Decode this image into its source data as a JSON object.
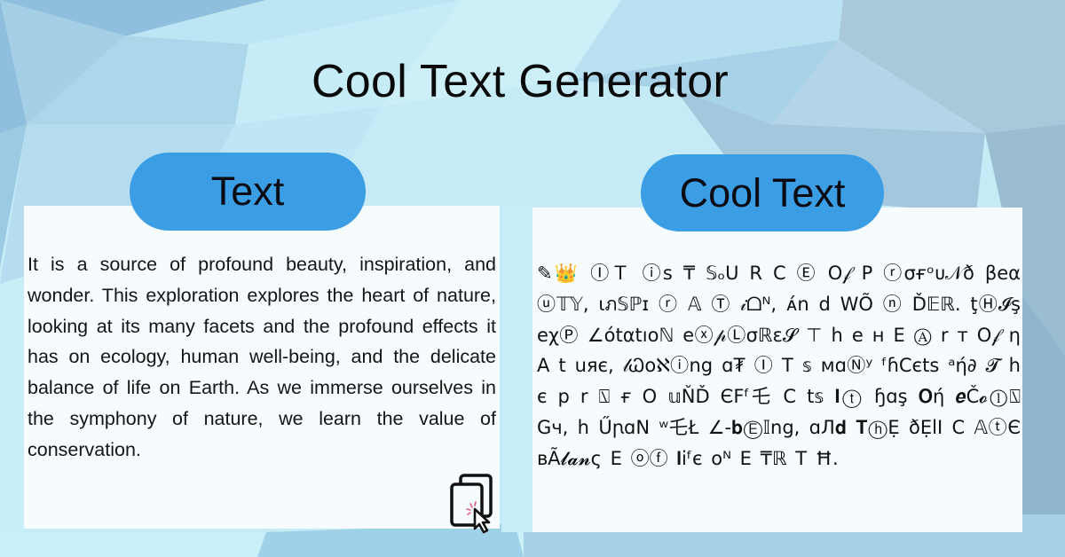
{
  "page": {
    "title": "Cool Text Generator"
  },
  "input_panel": {
    "label": "Text",
    "content": "It is a source of profound beauty, inspiration, and wonder. This exploration explores the heart of nature, looking at its many facets and the profound effects it has on ecology, human well-being, and the delicate balance of life on Earth. As we immerse ourselves in the symphony of nature, we learn the value of conservation."
  },
  "output_panel": {
    "label": "Cool Text",
    "content": "✎👑  ⒾＴ ⓘs ₸ 𝕊ₒU R C Ⓔ  O𝒻 P ⓡσғᵒᴜ𝒩ð βeα ⓤ𝕋𝕐, ɩภ𝕊ℙɪ ⓡ 𝔸 Ⓣ 𝒾ᗝᴺ, ᴀ́n d  WÕ ⓝ Ď𝔼ℝ. ţⒽ𝓘ş eχⓅ ∠ótαtıoℕ eⓧ𝓅Ⓛσℝɛ𝓢 ⊤ h e ʜ E Ⓐ r ᴛ O𝒻 η A  t uяє, 𝓁Ꮗoℵⓘng ɑ₮  Ⓘ T 𝕤 ᴍɑⓃʸ ᶠɦCєts ᵃή∂ 𝓣 h є  p r ⍂ ғ O 𝕦ŇĎ ЄFᶠ乇 C t𝕤 𝐈ⓣ  ɧɑş 𝐎ή 𝒆Č𝓸ⓛ⍂ Gч,  h ŰꞃɑN ʷ乇Ł ∠-𝐛Ⓔ𝕀ng, ɑЛ𝐝 𝐓ⓗẸ ðẸlI C 𝔸ⓣЄ ʙÃ𝓵𝓪𝓷ς E  ⓞⓕ 𝐥iᶠє ᴏᴺ  E ₸ℝ T Ħ."
  },
  "actions": {
    "copy_icon": "copy-icon"
  },
  "colors": {
    "pill": "#3b9ee5",
    "panel": "#f6fbfe",
    "background": "#bfe6f2",
    "text": "#111111"
  }
}
